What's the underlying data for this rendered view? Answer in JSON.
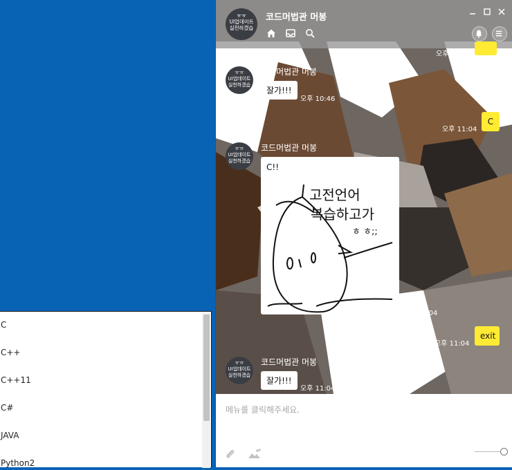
{
  "left_panel": {
    "items": [
      "C",
      "C++",
      "C++11",
      "C#",
      "JAVA",
      "Python2"
    ]
  },
  "chat": {
    "room_title": "코드머법관 머봉",
    "avatar_text": [
      "ㅠㅠ",
      "UI업데이트",
      "실천하겠습"
    ],
    "messages": [
      {
        "ts": "오후 10:46"
      },
      {
        "sender": "코드머법관 머봉",
        "text": "잘가!!!",
        "ts": "오후 10:46"
      },
      {
        "text": "C",
        "ts": "오후 11:04"
      },
      {
        "sender": "코드머법관 머봉",
        "text": "C!!",
        "ts": "오후 11:04"
      },
      {
        "text": "exit",
        "ts": "오후 11:04"
      },
      {
        "sender": "코드머법관 머봉",
        "text": "잘가!!!",
        "ts": "오후 11:04"
      }
    ],
    "image_text": {
      "line1": "고전언어",
      "line2": "복습하고가",
      "line3": "ㅎ ㅎ;;"
    },
    "input_placeholder": "메뉴를 클릭해주세요."
  },
  "colors": {
    "accent_yellow": "#ffeb33",
    "desktop_blue": "#0863b5"
  },
  "icons": [
    "home-icon",
    "inbox-icon",
    "search-icon",
    "bell-icon",
    "menu-icon",
    "minimize-icon",
    "maximize-icon",
    "close-icon",
    "paperclip-icon",
    "image-icon"
  ]
}
